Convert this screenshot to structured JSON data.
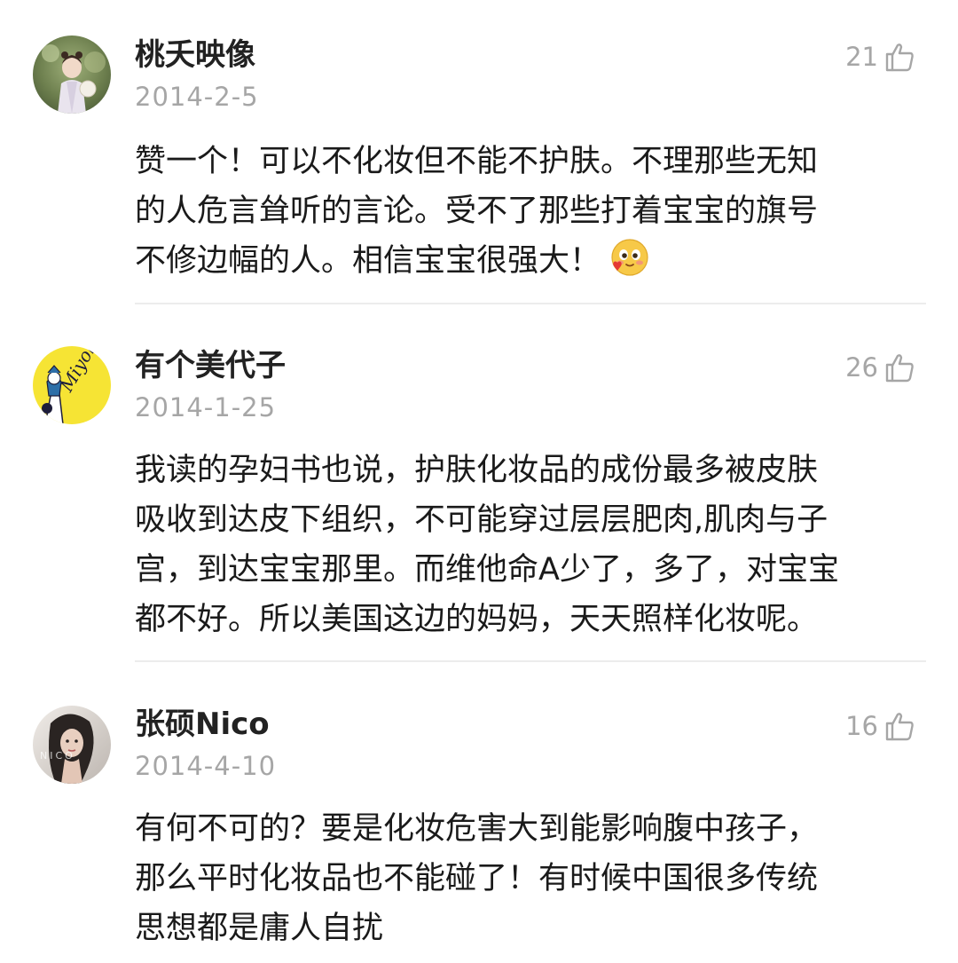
{
  "comments": [
    {
      "nickname": "桃夭映像",
      "date": "2014-2-5",
      "likes": "21",
      "lines": [
        "赞一个！可以不化妆但不能不护肤。不理那些无知",
        "的人危言耸听的言论。受不了那些打着宝宝的旗号",
        "不修边幅的人。相信宝宝很强大！"
      ],
      "emoji": "blush-heart-emoji-icon"
    },
    {
      "nickname": "有个美代子",
      "date": "2014-1-25",
      "likes": "26",
      "lines": [
        "我读的孕妇书也说，护肤化妆品的成份最多被皮肤",
        "吸收到达皮下组织，不可能穿过层层肥肉,肌肉与子",
        "宫，到达宝宝那里。而维他命A少了，多了，对宝宝",
        "都不好。所以美国这边的妈妈，天天照样化妆呢。"
      ],
      "avatar_text": "Miyoko!"
    },
    {
      "nickname": "张硕Nico",
      "date": "2014-4-10",
      "likes": "16",
      "lines": [
        "有何不可的？要是化妆危害大到能影响腹中孩子，",
        "那么平时化妆品也不能碰了！有时候中国很多传统",
        "思想都是庸人自扰"
      ],
      "avatar_text": "NICO"
    }
  ],
  "colors": {
    "name": "#222222",
    "meta": "#a6a6a6",
    "divider": "#ececec",
    "text": "#1a1a1a"
  }
}
